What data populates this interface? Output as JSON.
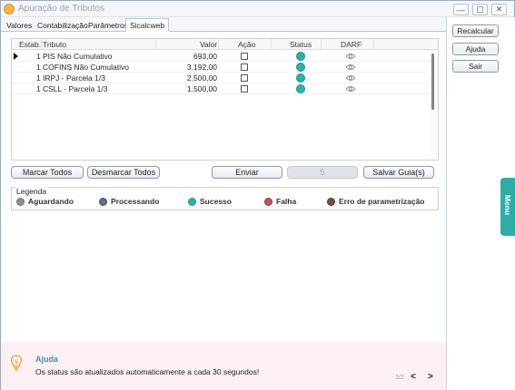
{
  "window": {
    "title": "Apuração de Tributos",
    "minimize_glyph": "—",
    "restore_glyph": "▢",
    "close_glyph": "✕"
  },
  "tabs": [
    {
      "label": "Valores"
    },
    {
      "label": "Contabilização"
    },
    {
      "label": "Parâmetros"
    },
    {
      "label": "Sicalcweb",
      "active": true
    }
  ],
  "grid": {
    "headers": {
      "estab": "Estab.",
      "tributo": "Tributo",
      "valor": "Valor",
      "acao": "Ação",
      "status": "Status",
      "darf": "DARF"
    },
    "rows": [
      {
        "estab": "1",
        "tributo": "PIS Não Cumulativo",
        "valor": "693,00",
        "acao_checked": false,
        "status": "Sucesso",
        "darf_icon": "eye-icon"
      },
      {
        "estab": "1",
        "tributo": "COFINS Não Cumulativo",
        "valor": "3.192,00",
        "acao_checked": false,
        "status": "Sucesso",
        "darf_icon": "eye-icon"
      },
      {
        "estab": "1",
        "tributo": "IRPJ - Parcela 1/3",
        "valor": "2.500,00",
        "acao_checked": false,
        "status": "Sucesso",
        "darf_icon": "eye-icon"
      },
      {
        "estab": "1",
        "tributo": "CSLL - Parcela 1/3",
        "valor": "1.500,00",
        "acao_checked": false,
        "status": "Sucesso",
        "darf_icon": "eye-icon"
      }
    ]
  },
  "buttons": {
    "marcar_todos": "Marcar Todos",
    "desmarcar_todos": "Desmarcar Todos",
    "enviar": "Enviar",
    "count": "5",
    "salvar_guias": "Salvar Guia(s)"
  },
  "legend": {
    "title": "Legenda",
    "items": [
      {
        "label": "Aguardando",
        "color": "#8a9099"
      },
      {
        "label": "Processando",
        "color": "#5b6f8f"
      },
      {
        "label": "Sucesso",
        "color": "#2bb3ab"
      },
      {
        "label": "Falha",
        "color": "#b8584e"
      },
      {
        "label": "Erro de parametrização",
        "color": "#7a4a3c"
      }
    ]
  },
  "sidebar": {
    "recalcular": "Recalcular",
    "ajuda": "Ajuda",
    "sair": "Sair",
    "menu": "Menu"
  },
  "help": {
    "title": "Ajuda",
    "text": "Os status são atualizados automaticamente a cada 30 segundos!",
    "pager": "1/2",
    "prev": "<",
    "next": ">"
  },
  "colors": {
    "accent": "#2aaea6",
    "success": "#2bb3ab",
    "help_bg": "#fcf0f3"
  }
}
